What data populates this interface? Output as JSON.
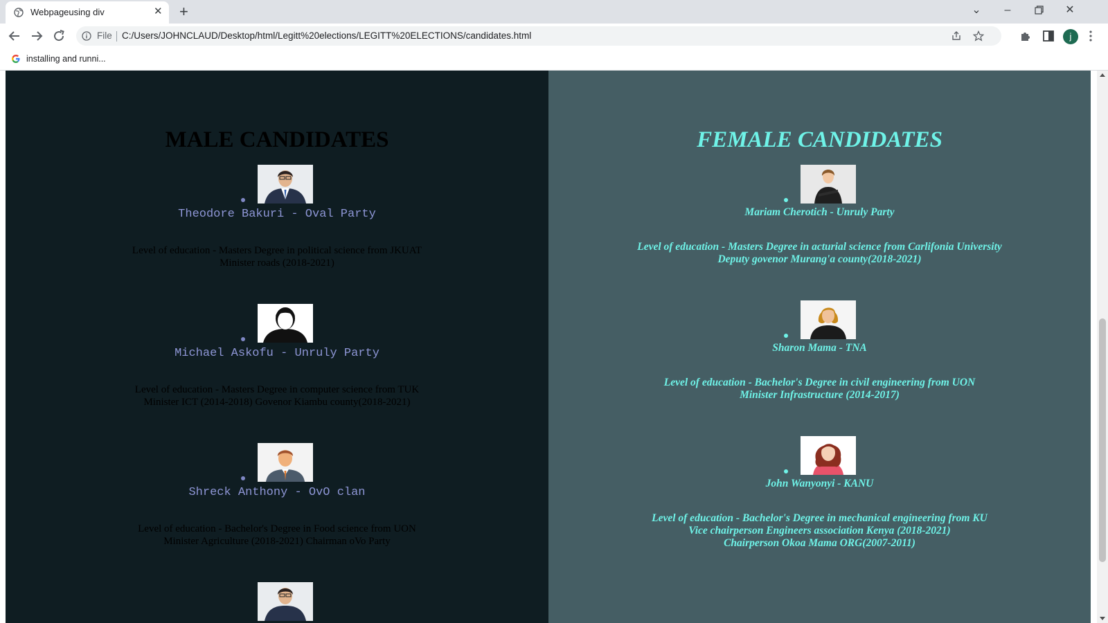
{
  "browser": {
    "tab_title": "Webpageusing div",
    "url_scheme": "File",
    "url": "C:/Users/JOHNCLAUD/Desktop/html/Legitt%20elections/LEGITT%20ELECTIONS/candidates.html",
    "profile_initial": "j",
    "bookmark_label": "installing and runni..."
  },
  "male": {
    "title": "MALE CANDIDATES",
    "candidates": [
      {
        "name": "Theodore Bakuri - Oval Party",
        "line1": "Level of education - Masters Degree in political science from JKUAT",
        "line2": "Minister roads (2018-2021)"
      },
      {
        "name": "Michael Askofu - Unruly Party",
        "line1": "Level of education - Masters Degree in computer science from TUK",
        "line2": "Minister ICT (2014-2018) Govenor Kiambu county(2018-2021)"
      },
      {
        "name": "Shreck Anthony - OvO clan",
        "line1": "Level of education - Bachelor's Degree in Food science from UON",
        "line2": "Minister Agriculture (2018-2021) Chairman oVo Party"
      }
    ]
  },
  "female": {
    "title": "FEMALE CANDIDATES",
    "candidates": [
      {
        "name": "Mariam Cherotich - Unruly Party",
        "line1": "Level of education - Masters Degree in acturial science from Carlifonia University",
        "line2": "Deputy govenor Murang'a county(2018-2021)"
      },
      {
        "name": "Sharon Mama - TNA",
        "line1": "Level of education - Bachelor's Degree in civil engineering from UON",
        "line2": "Minister Infrastructure (2014-2017)"
      },
      {
        "name": "John Wanyonyi - KANU",
        "line1": "Level of education - Bachelor's Degree in mechanical engineering from KU",
        "line2": "Vice chairperson Engineers association Kenya (2018-2021)",
        "line3": "Chairperson Okoa Mama ORG(2007-2011)"
      }
    ]
  }
}
